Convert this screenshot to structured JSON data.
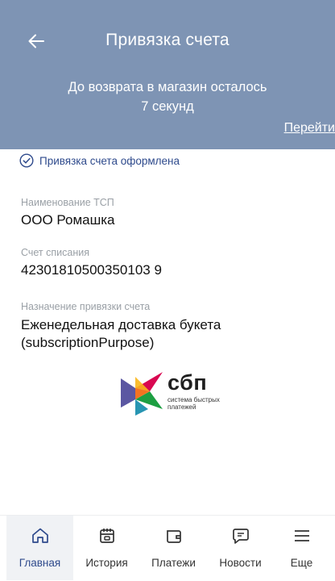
{
  "header": {
    "title": "Привязка счета",
    "timer_line1": "До возврата в магазин осталось",
    "timer_line2": "7 секунд",
    "goto_link": "Перейти"
  },
  "status": {
    "text": "Привязка счета оформлена"
  },
  "fields": {
    "merchant_label": "Наименование ТСП",
    "merchant_value": "ООО Ромашка",
    "account_label": "Счет списания",
    "account_value": "42301810500350103 9",
    "purpose_label": "Назначение привязки счета",
    "purpose_value": "Еженедельная доставка букета (subscriptionPurpose)"
  },
  "logo": {
    "word": "сбп",
    "sub_line1": "система быстрых",
    "sub_line2": "платежей"
  },
  "nav": {
    "items": [
      {
        "label": "Главная",
        "icon": "home-icon"
      },
      {
        "label": "История",
        "icon": "calendar-icon"
      },
      {
        "label": "Платежи",
        "icon": "wallet-icon"
      },
      {
        "label": "Новости",
        "icon": "message-icon"
      },
      {
        "label": "Еще",
        "icon": "menu-icon"
      }
    ]
  },
  "colors": {
    "header_bg": "#7e94b4",
    "accent": "#2e4a8c"
  }
}
